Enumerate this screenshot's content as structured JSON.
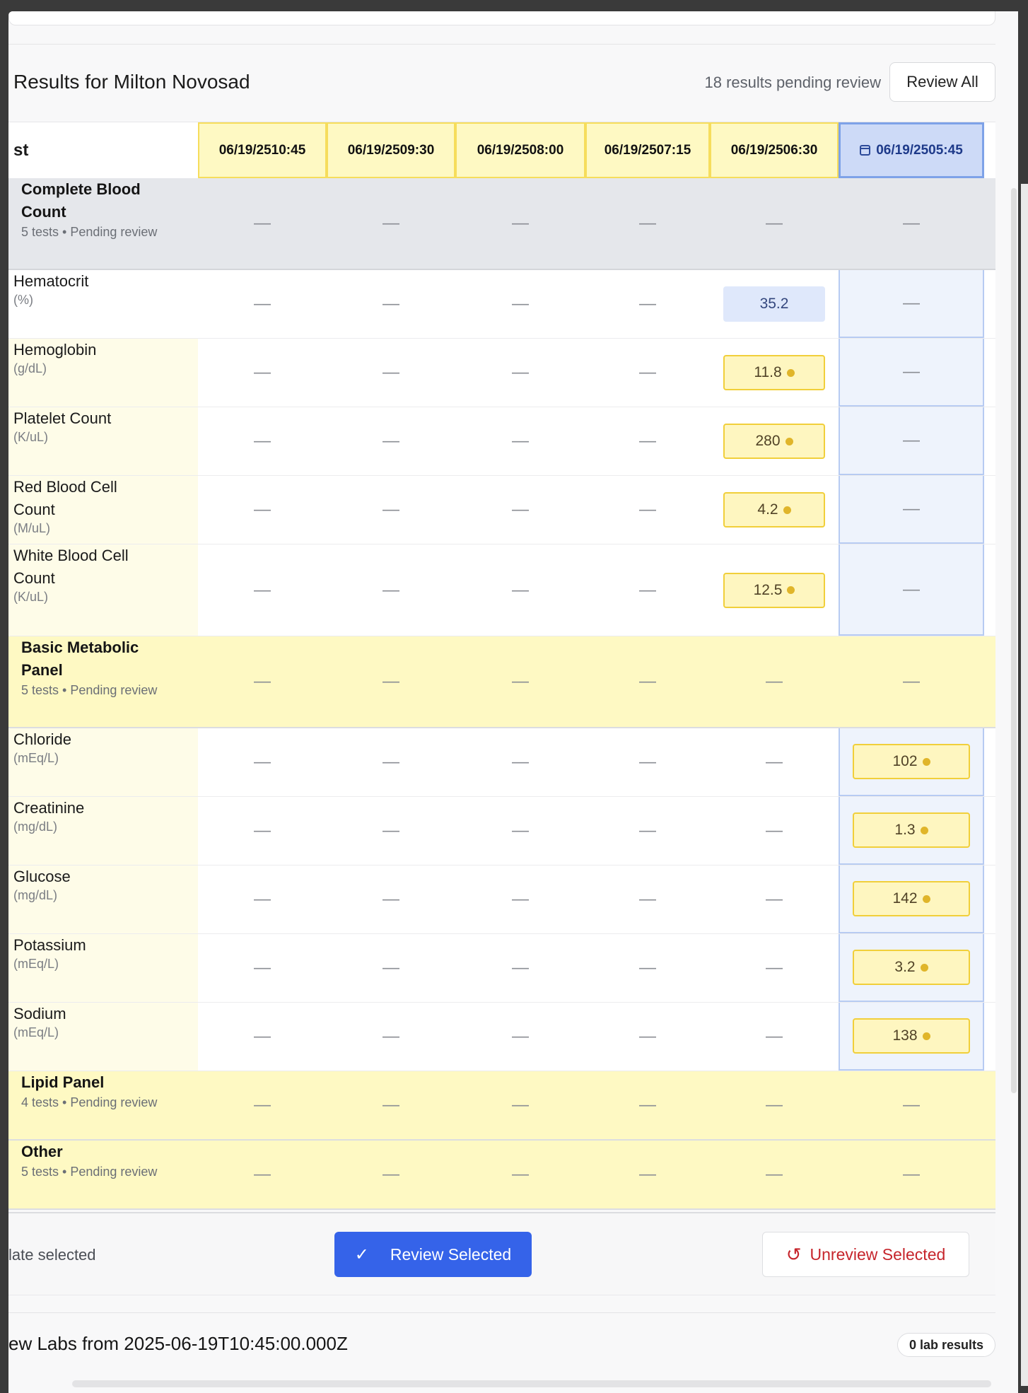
{
  "results": {
    "title": "Results for Milton Novosad",
    "pending_text": "18 results pending review",
    "review_all_label": "Review All",
    "test_col_header": "st",
    "dates": [
      "06/19/2510:45",
      "06/19/2509:30",
      "06/19/2508:00",
      "06/19/2507:15",
      "06/19/2506:30",
      "06/19/2505:45"
    ],
    "selected_date_index": 5,
    "empty_value": "—",
    "rows": [
      {
        "type": "group",
        "name": "Complete Blood Count",
        "meta": "5 tests • Pending review"
      },
      {
        "type": "test",
        "name": "Hematocrit",
        "unit": "(%)",
        "values": [
          null,
          null,
          null,
          null,
          "35.2",
          null
        ],
        "reviewed": true
      },
      {
        "type": "test",
        "name": "Hemoglobin",
        "unit": "(g/dL)",
        "values": [
          null,
          null,
          null,
          null,
          "11.8",
          null
        ]
      },
      {
        "type": "test",
        "name": "Platelet Count",
        "unit": "(K/uL)",
        "values": [
          null,
          null,
          null,
          null,
          "280",
          null
        ]
      },
      {
        "type": "test",
        "name": "Red Blood Cell Count",
        "unit": "(M/uL)",
        "values": [
          null,
          null,
          null,
          null,
          "4.2",
          null
        ]
      },
      {
        "type": "test",
        "name": "White Blood Cell Count",
        "unit": "(K/uL)",
        "values": [
          null,
          null,
          null,
          null,
          "12.5",
          null
        ]
      },
      {
        "type": "group",
        "name": "Basic Metabolic Panel",
        "meta": "5 tests • Pending review"
      },
      {
        "type": "test",
        "name": "Chloride",
        "unit": "(mEq/L)",
        "values": [
          null,
          null,
          null,
          null,
          null,
          "102"
        ]
      },
      {
        "type": "test",
        "name": "Creatinine",
        "unit": "(mg/dL)",
        "values": [
          null,
          null,
          null,
          null,
          null,
          "1.3"
        ]
      },
      {
        "type": "test",
        "name": "Glucose",
        "unit": "(mg/dL)",
        "values": [
          null,
          null,
          null,
          null,
          null,
          "142"
        ]
      },
      {
        "type": "test",
        "name": "Potassium",
        "unit": "(mEq/L)",
        "values": [
          null,
          null,
          null,
          null,
          null,
          "3.2"
        ]
      },
      {
        "type": "test",
        "name": "Sodium",
        "unit": "(mEq/L)",
        "values": [
          null,
          null,
          null,
          null,
          null,
          "138"
        ]
      },
      {
        "type": "group",
        "name": "Lipid Panel",
        "meta": "4 tests • Pending review"
      },
      {
        "type": "group",
        "name": "Other",
        "meta": "5 tests • Pending review"
      }
    ]
  },
  "footer": {
    "selection_note": "late selected",
    "review_selected_label": "Review Selected",
    "unreview_selected_label": "Unreview Selected"
  },
  "new_labs": {
    "title": "ew Labs from 2025-06-19T10:45:00.000Z",
    "count_label": "0 lab results"
  },
  "colors": {
    "primary": "#3563e9",
    "danger": "#c6252c",
    "pending_yellow": "#fef6c0",
    "selected_blue": "#cddaf7"
  },
  "icons": {
    "calendar": "calendar-icon",
    "check": "check-icon",
    "undo": "undo-icon",
    "pending_dot": "pending-dot-icon"
  }
}
